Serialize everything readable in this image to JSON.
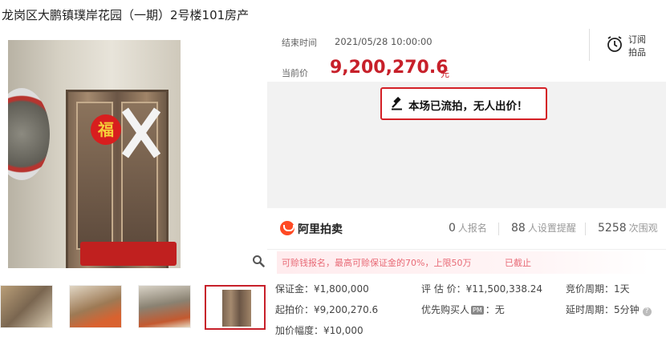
{
  "title": "龙岗区大鹏镇璞岸花园（一期）2号楼101房产",
  "auction": {
    "end_label": "结束时间",
    "end_time": "2021/05/28 10:00:00",
    "current_price_label": "当前价",
    "current_price": "9,200,270.6",
    "price_unit": "元",
    "remind_label": "订阅拍品",
    "notice": "本场已流拍，无人出价！"
  },
  "stats": {
    "brand": "阿里拍卖",
    "signup_count": "0",
    "signup_unit": "人报名",
    "reminder_count": "88",
    "reminder_unit": "人设置提醒",
    "view_count": "5258",
    "view_unit": "次围观"
  },
  "warning": {
    "text": "可赊钱报名，最高可赊保证金的70%，上限50万",
    "status": "已截止"
  },
  "details": {
    "deposit": "保证金：¥1,800,000",
    "start_price": "起拍价：¥9,200,270.6",
    "increment": "加价幅度：¥10,000",
    "appraisal": "评 估 价：¥11,500,338.24",
    "priority_prefix": "优先购买人",
    "priority_badge": "PM",
    "priority_suffix": "：无",
    "bid_cycle": "竞价周期：1天",
    "extension_cycle": "延时周期：5分钟"
  },
  "colors": {
    "accent": "#c7202a",
    "warning_text": "#e86a76",
    "brand_orange": "#ff4a24"
  }
}
